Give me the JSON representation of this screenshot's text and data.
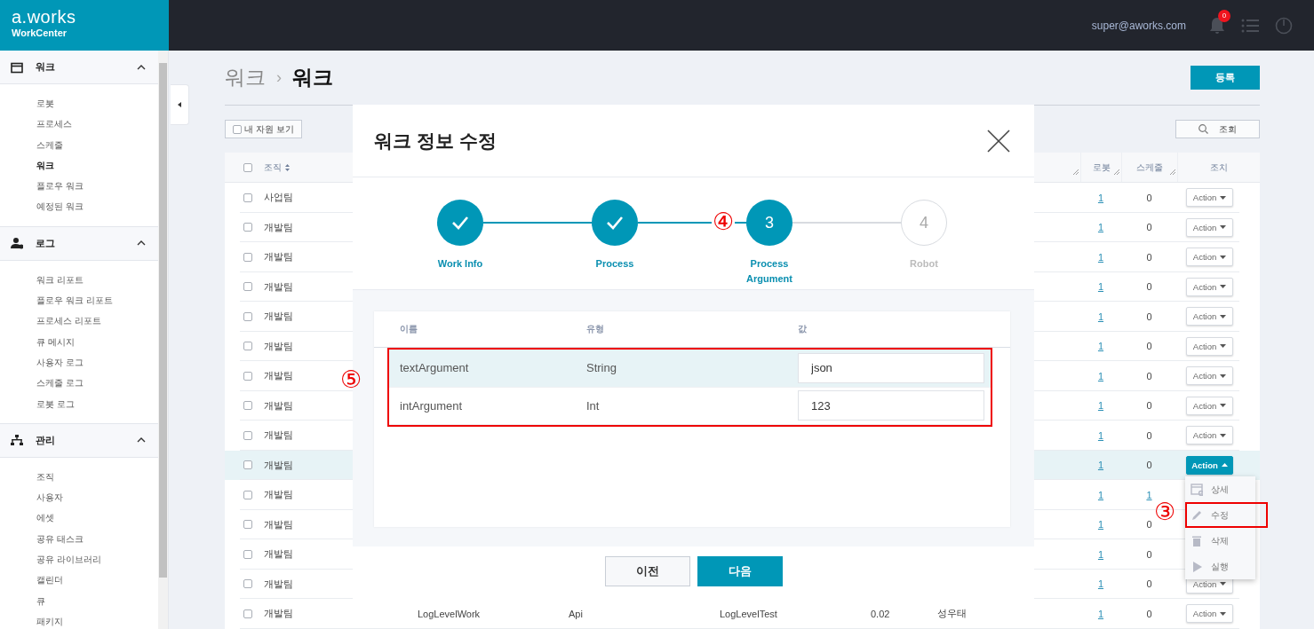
{
  "header": {
    "logo": "a.works",
    "product": "WorkCenter",
    "user": "super@aworks.com",
    "notification_count": "0"
  },
  "sidebar": {
    "sections": [
      {
        "title": "워크",
        "expanded": true,
        "items": [
          {
            "label": "로봇",
            "selected": false
          },
          {
            "label": "프로세스",
            "selected": false
          },
          {
            "label": "스케줄",
            "selected": false
          },
          {
            "label": "워크",
            "selected": true
          },
          {
            "label": "플로우 워크",
            "selected": false
          },
          {
            "label": "예정된 워크",
            "selected": false
          }
        ]
      },
      {
        "title": "로그",
        "expanded": true,
        "items": [
          {
            "label": "워크 리포트",
            "selected": false
          },
          {
            "label": "플로우 워크 리포트",
            "selected": false
          },
          {
            "label": "프로세스 리포트",
            "selected": false
          },
          {
            "label": "큐 메시지",
            "selected": false
          },
          {
            "label": "사용자 로그",
            "selected": false
          },
          {
            "label": "스케줄 로그",
            "selected": false
          },
          {
            "label": "로봇 로그",
            "selected": false
          }
        ]
      },
      {
        "title": "관리",
        "expanded": true,
        "items": [
          {
            "label": "조직",
            "selected": false
          },
          {
            "label": "사용자",
            "selected": false
          },
          {
            "label": "에셋",
            "selected": false
          },
          {
            "label": "공유 태스크",
            "selected": false
          },
          {
            "label": "공유 라이브러리",
            "selected": false
          },
          {
            "label": "캘린더",
            "selected": false
          },
          {
            "label": "큐",
            "selected": false
          },
          {
            "label": "패키지",
            "selected": false
          }
        ]
      }
    ]
  },
  "page": {
    "breadcrumb": [
      "워크",
      "워크"
    ],
    "breadcrumb_separator": "›",
    "register_button": "등록",
    "my_resources": {
      "label": "내 자원 보기",
      "checked": false
    },
    "search_button": "조회"
  },
  "table": {
    "all_checked": false,
    "columns": [
      {
        "label": "조직",
        "sortable": true
      },
      {
        "label": "로봇",
        "sortable": false
      },
      {
        "label": "스케줄",
        "sortable": false
      },
      {
        "label": "조치",
        "sortable": false
      }
    ],
    "rows": [
      {
        "org": "사업팀",
        "checked": false,
        "selected": false,
        "robot": "1",
        "schedule": "0",
        "schedule_link": false,
        "action": "Action",
        "action_open": false
      },
      {
        "org": "개발팀",
        "checked": false,
        "selected": false,
        "robot": "1",
        "schedule": "0",
        "schedule_link": false,
        "action": "Action",
        "action_open": false
      },
      {
        "org": "개발팀",
        "checked": false,
        "selected": false,
        "robot": "1",
        "schedule": "0",
        "schedule_link": false,
        "action": "Action",
        "action_open": false
      },
      {
        "org": "개발팀",
        "checked": false,
        "selected": false,
        "robot": "1",
        "schedule": "0",
        "schedule_link": false,
        "action": "Action",
        "action_open": false
      },
      {
        "org": "개발팀",
        "checked": false,
        "selected": false,
        "robot": "1",
        "schedule": "0",
        "schedule_link": false,
        "action": "Action",
        "action_open": false
      },
      {
        "org": "개발팀",
        "checked": false,
        "selected": false,
        "robot": "1",
        "schedule": "0",
        "schedule_link": false,
        "action": "Action",
        "action_open": false
      },
      {
        "org": "개발팀",
        "checked": false,
        "selected": false,
        "robot": "1",
        "schedule": "0",
        "schedule_link": false,
        "action": "Action",
        "action_open": false
      },
      {
        "org": "개발팀",
        "checked": false,
        "selected": false,
        "robot": "1",
        "schedule": "0",
        "schedule_link": false,
        "action": "Action",
        "action_open": false
      },
      {
        "org": "개발팀",
        "checked": false,
        "selected": false,
        "robot": "1",
        "schedule": "0",
        "schedule_link": false,
        "action": "Action",
        "action_open": false
      },
      {
        "org": "개발팀",
        "checked": false,
        "selected": true,
        "robot": "1",
        "schedule": "0",
        "schedule_link": false,
        "action": "Action",
        "action_open": true
      },
      {
        "org": "개발팀",
        "checked": false,
        "selected": false,
        "robot": "1",
        "schedule": "1",
        "schedule_link": true
      },
      {
        "org": "개발팀",
        "checked": false,
        "selected": false,
        "robot": "1",
        "schedule": "0",
        "schedule_link": false
      },
      {
        "org": "개발팀",
        "checked": false,
        "selected": false,
        "robot": "1",
        "schedule": "0",
        "schedule_link": false
      },
      {
        "org": "개발팀",
        "checked": false,
        "selected": false,
        "robot": "1",
        "schedule": "0",
        "schedule_link": false,
        "action": "Action",
        "action_open": false
      },
      {
        "org": "개발팀",
        "checked": false,
        "selected": false,
        "robot": "1",
        "schedule": "0",
        "schedule_link": false,
        "action": "Action",
        "action_open": false,
        "cells": [
          "LogLevelWork",
          "Api",
          "LogLevelTest",
          "0.02",
          "성우태"
        ]
      }
    ],
    "action_menu": {
      "marker": "③",
      "items": [
        {
          "label": "상세",
          "kind": "detail",
          "highlighted": false
        },
        {
          "label": "수정",
          "kind": "edit",
          "highlighted": true
        },
        {
          "label": "삭제",
          "kind": "delete",
          "highlighted": false
        },
        {
          "label": "실행",
          "kind": "run",
          "highlighted": false
        }
      ]
    }
  },
  "modal": {
    "title": "워크 정보 수정",
    "steps_marker": "④",
    "steps": [
      {
        "label": "Work Info",
        "completed": true,
        "reached": true
      },
      {
        "label": "Process",
        "completed": true,
        "reached": true
      },
      {
        "label": "Process Argument",
        "completed": false,
        "reached": true,
        "number": "3"
      },
      {
        "label": "Robot",
        "completed": false,
        "reached": false,
        "number": "4"
      }
    ],
    "arguments": {
      "marker": "⑤",
      "highlighted": true,
      "columns": [
        "이름",
        "유형",
        "값"
      ],
      "rows": [
        {
          "name": "textArgument",
          "type": "String",
          "value": "json",
          "selected": true
        },
        {
          "name": "intArgument",
          "type": "Int",
          "value": "123",
          "selected": false
        }
      ]
    },
    "buttons": {
      "previous": "이전",
      "next": "다음"
    }
  }
}
